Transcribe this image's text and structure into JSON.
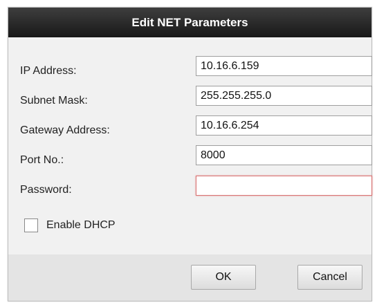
{
  "dialog": {
    "title": "Edit NET Parameters"
  },
  "form": {
    "ip_label": "IP Address:",
    "ip_value": "10.16.6.159",
    "subnet_label": "Subnet Mask:",
    "subnet_value": "255.255.255.0",
    "gateway_label": "Gateway Address:",
    "gateway_value": "10.16.6.254",
    "port_label": "Port No.:",
    "port_value": "8000",
    "password_label": "Password:",
    "password_value": "",
    "dhcp_label": "Enable DHCP",
    "dhcp_checked": false
  },
  "buttons": {
    "ok_label": "OK",
    "cancel_label": "Cancel"
  },
  "colors": {
    "titlebar": "#2a2a2a",
    "dialog_bg": "#f1f1f1",
    "active_border": "#d97373"
  }
}
